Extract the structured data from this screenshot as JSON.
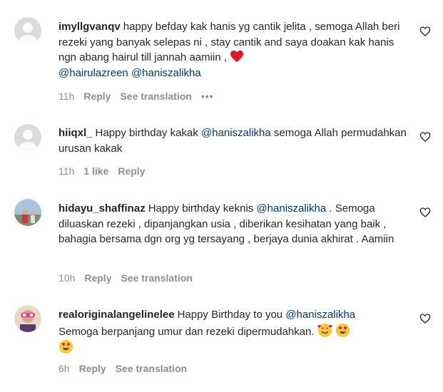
{
  "comments": [
    {
      "username": "imyllgvanqv",
      "text": "happy befday kak hanis yg cantik jelita , semoga Allah beri rezeki yang banyak selepas ni , stay cantik and saya doakan kak hanis ngn abang hairul till jannah aamiin ,",
      "emoji": "red-heart",
      "mentions": [
        "@hairulazreen",
        "@haniszalikha"
      ],
      "time": "11h",
      "reply_label": "Reply",
      "translate_label": "See translation",
      "more_label": "•••"
    },
    {
      "username": "hiiqxl_",
      "text_before": "Happy birthday kakak",
      "mention": "@haniszalikha",
      "text_after": "semoga Allah permudahkan urusan kakak",
      "time": "11h",
      "likes_label": "1 like",
      "reply_label": "Reply"
    },
    {
      "username": "hidayu_shaffinaz",
      "text_before": "Happy birthday keknis",
      "mention": "@haniszalikha",
      "text_after": ". Semoga diluaskan rezeki , dipanjangkan usia , diberikan kesihatan yang baik , bahagia bersama dgn org yg tersayang , berjaya dunia akhirat . Aamiin",
      "time": "10h",
      "reply_label": "Reply",
      "translate_label": "See translation"
    },
    {
      "username": "realoriginalangelinelee",
      "text_before": "Happy Birthday to you",
      "mention": "@haniszalikha",
      "text_after": "Semoga berpanjang umur dan rezeki dipermudahkan.",
      "emojis": [
        "smiling-face-with-hearts",
        "heart-eyes",
        "heart-eyes"
      ],
      "time": "6h",
      "reply_label": "Reply",
      "translate_label": "See translation"
    }
  ]
}
